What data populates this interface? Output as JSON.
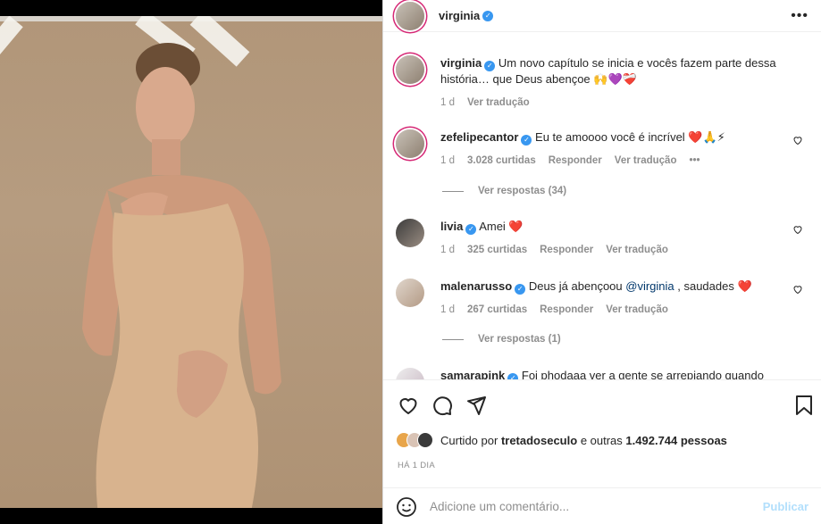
{
  "post": {
    "author": "virginia"
  },
  "caption": {
    "author": "virginia",
    "text": "Um novo capítulo se inicia e vocês fazem parte dessa história… que Deus abençoe 🙌💜❤️‍🩹",
    "time": "1 d",
    "translate": "Ver tradução"
  },
  "comments": [
    {
      "author": "zefelipecantor",
      "text": "Eu te amoooo você é incrível ❤️🙏⚡",
      "time": "1 d",
      "likes": "3.028 curtidas",
      "reply": "Responder",
      "translate": "Ver tradução",
      "more": "•••",
      "replies": "Ver respostas (34)"
    },
    {
      "author": "livia",
      "text": "Amei ❤️",
      "time": "1 d",
      "likes": "325 curtidas",
      "reply": "Responder",
      "translate": "Ver tradução"
    },
    {
      "author": "malenarusso",
      "text_before": "Deus já abençoou ",
      "mention": "@virginia",
      "text_after": " , saudades ❤️",
      "time": "1 d",
      "likes": "267 curtidas",
      "reply": "Responder",
      "translate": "Ver tradução",
      "replies": "Ver respostas (1)"
    },
    {
      "author": "samarapink",
      "text": "Foi phodaaa ver a gente se arrepiando quando"
    }
  ],
  "likes": {
    "prefix": "Curtido por",
    "user": "tretadoseculo",
    "middle": "e outras",
    "count": "1.492.744 pessoas"
  },
  "posted_ago": "HÁ 1 DIA",
  "add_comment": {
    "placeholder": "Adicione um comentário...",
    "publish": "Publicar"
  },
  "colors": {
    "verified": "#3897f0",
    "publish": "#b2dffc",
    "mention": "#00376b",
    "muted": "#8e8e8e"
  },
  "icons": [
    "heart-icon",
    "comment-icon",
    "share-icon",
    "bookmark-icon",
    "emoji-icon",
    "more-icon",
    "verified-icon"
  ]
}
